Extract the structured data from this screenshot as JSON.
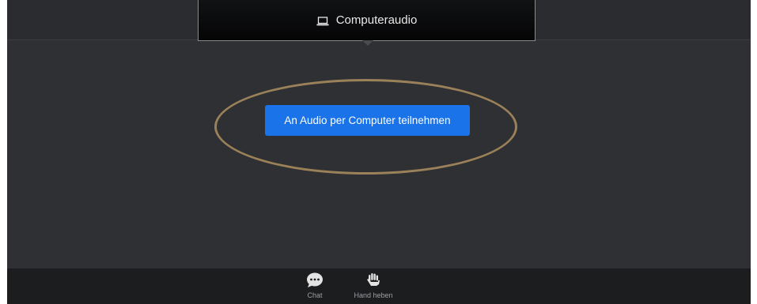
{
  "audio_tab": {
    "label": "Computeraudio",
    "icon": "laptop-icon"
  },
  "join_button": {
    "label": "An Audio per Computer teilnehmen",
    "color": "#1a73e8"
  },
  "highlight": {
    "color": "#9a8159"
  },
  "toolbar": {
    "items": [
      {
        "label": "Chat",
        "icon": "chat-bubble-icon"
      },
      {
        "label": "Hand heben",
        "icon": "raise-hand-icon"
      }
    ]
  }
}
